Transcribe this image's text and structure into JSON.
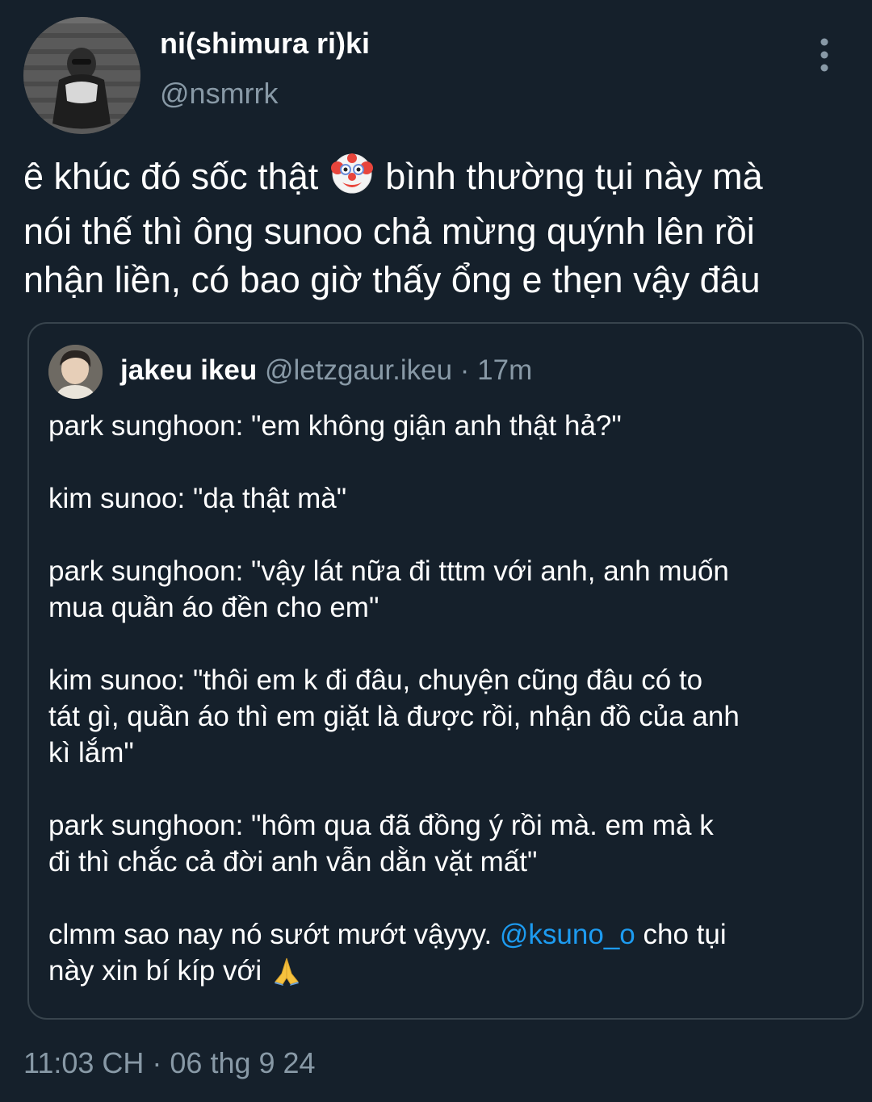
{
  "tweet": {
    "author": {
      "display_name": "ni(shimura ri)ki",
      "handle": "@nsmrrk"
    },
    "more_icon": "more-vertical-icon",
    "text_lines": [
      {
        "before": "ê khúc đó sốc thật ",
        "emoji": "clown-face-icon",
        "after": " bình thường tụi này mà"
      },
      "nói thế thì ông sunoo chả mừng quýnh lên rồi",
      "nhận liền, có bao giờ thấy ổng e thẹn vậy đâu"
    ],
    "timestamp": "11:03 CH · 06 thg 9 24"
  },
  "quote": {
    "author_name": "jakeu ikeu",
    "handle": "@letzgaur.ikeu",
    "separator": " · ",
    "time": "17m",
    "lines": [
      "park sunghoon: \"em không giận anh thật hả?\"",
      "",
      "kim sunoo: \"dạ thật mà\"",
      "",
      "park sunghoon: \"vậy lát nữa đi tttm với anh, anh muốn",
      "mua quần áo đền cho em\"",
      "",
      "kim sunoo: \"thôi em k đi đâu, chuyện cũng đâu có to",
      "tát gì, quần áo thì em giặt là được rồi, nhận đồ của anh",
      "kì lắm\"",
      "",
      "park sunghoon: \"hôm qua đã đồng ý rồi mà. em mà k",
      "đi thì chắc cả đời anh vẫn dằn vặt mất\""
    ],
    "last_line_1": {
      "before": "clmm sao nay nó sướt mướt vậyyy. ",
      "mention": "@ksuno_o",
      "after": " cho tụi"
    },
    "last_line_2": {
      "text": "này xin bí kíp với ",
      "emoji": "folded-hands-icon"
    }
  },
  "colors": {
    "background": "#15202b",
    "text": "#ffffff",
    "secondary": "#8899a6",
    "border": "#38444d",
    "link": "#1d9bf0"
  }
}
